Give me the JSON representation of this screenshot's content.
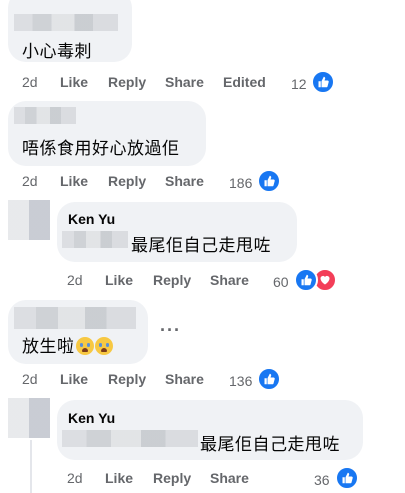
{
  "comments": [
    {
      "text": "小心毒刺",
      "actions": {
        "time": "2d",
        "like": "Like",
        "reply": "Reply",
        "share": "Share",
        "edited": "Edited"
      },
      "reaction_count": "12",
      "reactions": [
        "like-icon"
      ]
    },
    {
      "text": "唔係食用好心放過佢",
      "actions": {
        "time": "2d",
        "like": "Like",
        "reply": "Reply",
        "share": "Share"
      },
      "reaction_count": "186",
      "reactions": [
        "like-icon"
      ]
    },
    {
      "author": "Ken Yu",
      "text": "最尾佢自己走甩咗",
      "actions": {
        "time": "2d",
        "like": "Like",
        "reply": "Reply",
        "share": "Share"
      },
      "reaction_count": "60",
      "reactions": [
        "like-icon",
        "heart-icon"
      ]
    },
    {
      "text": "放生啦",
      "emojis": [
        "crying-face-emoji",
        "crying-face-emoji"
      ],
      "more_label": "···",
      "actions": {
        "time": "2d",
        "like": "Like",
        "reply": "Reply",
        "share": "Share"
      },
      "reaction_count": "136",
      "reactions": [
        "like-icon"
      ]
    },
    {
      "author": "Ken Yu",
      "text": "最尾佢自己走甩咗",
      "actions": {
        "time": "2d",
        "like": "Like",
        "reply": "Reply",
        "share": "Share"
      },
      "reaction_count": "36",
      "reactions": [
        "like-icon"
      ]
    }
  ],
  "colors": {
    "bubble": "#f0f2f5",
    "like_blue": "#1877f2",
    "heart_red": "#f33e58",
    "secondary_text": "#65676b"
  }
}
